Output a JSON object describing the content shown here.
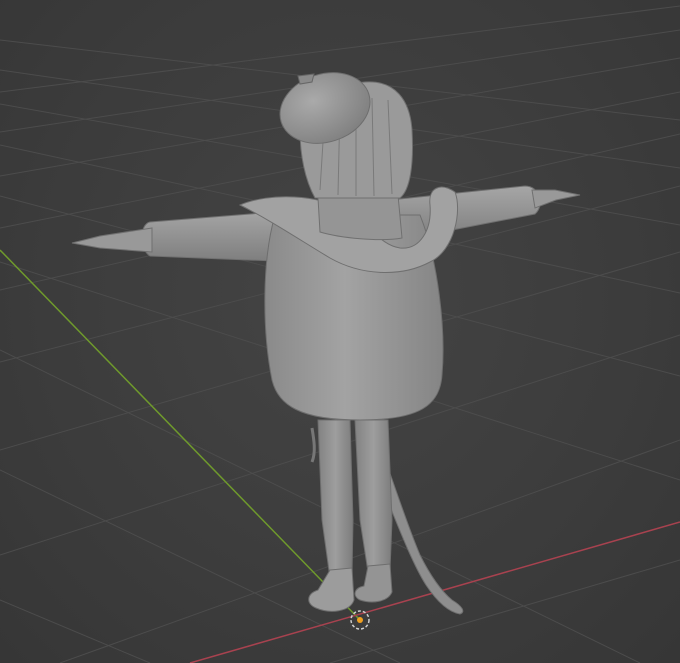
{
  "viewport": {
    "background": "#3d3d3d",
    "grid_color": "#4f4f4f",
    "x_axis_color": "#a8424f",
    "y_axis_color": "#6f9a2c",
    "model_color": "#9a9a9a",
    "origin_marker_color": "#f0a020"
  },
  "scene": {
    "object": "character-model",
    "pose": "T-pose",
    "view": "perspective"
  }
}
